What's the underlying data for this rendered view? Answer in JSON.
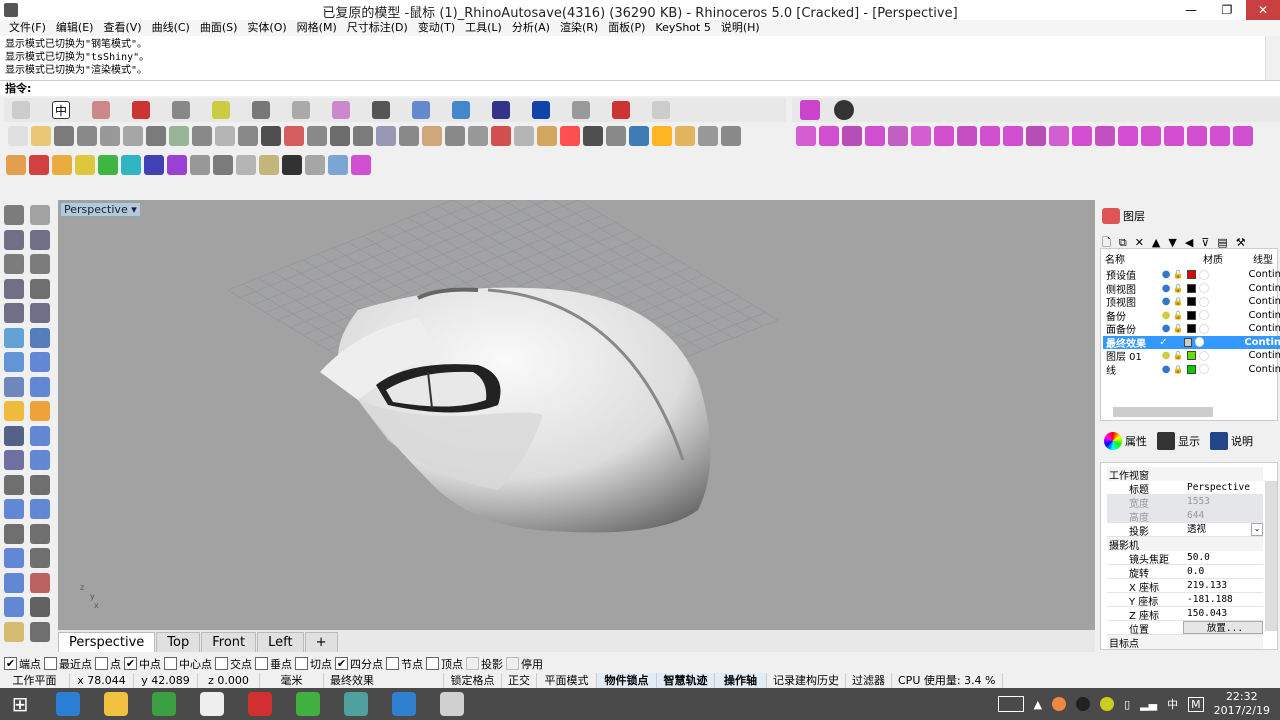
{
  "window": {
    "title": "已复原的模型 -鼠标 (1)_RhinoAutosave(4316) (36290 KB) - Rhinoceros 5.0 [Cracked] - [Perspective]",
    "min": "—",
    "max": "❐",
    "close": "✕",
    "close_color": "#c94040"
  },
  "menu": [
    "文件(F)",
    "编辑(E)",
    "查看(V)",
    "曲线(C)",
    "曲面(S)",
    "实体(O)",
    "网格(M)",
    "尺寸标注(D)",
    "变动(T)",
    "工具(L)",
    "分析(A)",
    "渲染(R)",
    "面板(P)",
    "KeyShot 5",
    "说明(H)"
  ],
  "history": [
    "显示模式已切换为\"钢笔模式\"。",
    "显示模式已切换为\"tsShiny\"。",
    "显示模式已切换为\"渲染模式\"。"
  ],
  "command": {
    "label": "指令:",
    "value": ""
  },
  "toolbar_tabs_left_active": "中",
  "toolbar_colors": {
    "row1": [
      "#ddd",
      "#e8c060",
      "#666",
      "#777",
      "#888",
      "#999",
      "#666",
      "#8a8",
      "#777",
      "#aaa",
      "#777",
      "#333",
      "#c44",
      "#777",
      "#555",
      "#666",
      "#88a",
      "#777",
      "#c96",
      "#777",
      "#888",
      "#c33",
      "#aaa",
      "#c94",
      "#f33",
      "#333",
      "#777",
      "#26a",
      "#fa0",
      "#da4",
      "#888",
      "#777"
    ],
    "row1b": [
      "#c4c",
      "#c3c",
      "#a3a",
      "#c3c",
      "#b4b",
      "#c4c",
      "#c3c",
      "#b3b",
      "#c3c",
      "#c3c",
      "#a3a",
      "#c4c",
      "#c3c",
      "#b3b",
      "#c3c",
      "#c3c",
      "#c3c",
      "#c3c",
      "#c3c",
      "#c3c"
    ],
    "row2": [
      "#e09030",
      "#c22",
      "#e8a020",
      "#d8c020",
      "#2a2",
      "#1ab",
      "#22a",
      "#82c",
      "#888",
      "#666",
      "#aaa",
      "#ba6",
      "#111",
      "#999",
      "#69c",
      "#c3c"
    ]
  },
  "viewport": {
    "label": "Perspective",
    "background": "#a2a2a2",
    "axis": [
      "z",
      "y",
      "x"
    ]
  },
  "viewport_tabs": [
    "Perspective",
    "Top",
    "Front",
    "Left",
    "+"
  ],
  "osnap": [
    {
      "label": "端点",
      "checked": true
    },
    {
      "label": "最近点",
      "checked": false
    },
    {
      "label": "点",
      "checked": false
    },
    {
      "label": "中点",
      "checked": true
    },
    {
      "label": "中心点",
      "checked": false
    },
    {
      "label": "交点",
      "checked": false
    },
    {
      "label": "垂点",
      "checked": false
    },
    {
      "label": "切点",
      "checked": false
    },
    {
      "label": "四分点",
      "checked": true
    },
    {
      "label": "节点",
      "checked": false
    },
    {
      "label": "顶点",
      "checked": false
    },
    {
      "label": "投影",
      "checked": false,
      "disabled": true
    },
    {
      "label": "停用",
      "checked": false,
      "disabled": true
    }
  ],
  "status": {
    "cplane": "工作平面",
    "x": "x 78.044",
    "y": "y 42.089",
    "z": "z 0.000",
    "units": "毫米",
    "layer": "最终效果",
    "grid_snap": "锁定格点",
    "ortho": "正交",
    "planar": "平面模式",
    "osnap": "物件锁点",
    "smarttrack": "智慧轨迹",
    "gumball": "操作轴",
    "history": "记录建构历史",
    "filter": "过滤器",
    "cpu": "CPU 使用量: 3.4 %"
  },
  "layers": {
    "tab": "图层",
    "headers": [
      "名称",
      "材质",
      "线型"
    ],
    "rows": [
      {
        "name": "预设值",
        "color": "#e00000",
        "lock": "unlocked",
        "light": "on",
        "linetype": "Contin"
      },
      {
        "name": "侧视图",
        "color": "#000000",
        "lock": "unlocked",
        "light": "on",
        "linetype": "Contin"
      },
      {
        "name": "顶视图",
        "color": "#000000",
        "lock": "locked",
        "light": "on",
        "linetype": "Contin"
      },
      {
        "name": "备份",
        "color": "#000000",
        "lock": "unlocked",
        "light": "off",
        "linetype": "Contin"
      },
      {
        "name": "面备份",
        "color": "#000000",
        "lock": "unlocked",
        "light": "on",
        "linetype": "Contin"
      },
      {
        "name": "最终效果",
        "color": "#cccccc",
        "current": true,
        "linetype": "Contin",
        "selected": true
      },
      {
        "name": "图层 01",
        "color": "#66dd00",
        "lock": "unlocked",
        "light": "off",
        "linetype": "Contin"
      },
      {
        "name": "线",
        "color": "#00cc00",
        "lock": "locked",
        "light": "on",
        "linetype": "Contin"
      }
    ]
  },
  "properties": {
    "tabs": [
      "属性",
      "显示",
      "说明"
    ],
    "sections": [
      {
        "title": "工作视窗",
        "rows": [
          {
            "k": "标题",
            "v": "Perspective"
          },
          {
            "k": "宽度",
            "v": "1553",
            "disabled": true
          },
          {
            "k": "高度",
            "v": "644",
            "disabled": true
          },
          {
            "k": "投影",
            "v": "透视",
            "dropdown": true
          }
        ]
      },
      {
        "title": "摄影机",
        "rows": [
          {
            "k": "镜头焦距",
            "v": "50.0"
          },
          {
            "k": "旋转",
            "v": "0.0"
          },
          {
            "k": "X 座标",
            "v": "219.133"
          },
          {
            "k": "Y 座标",
            "v": "-181.188"
          },
          {
            "k": "Z 座标",
            "v": "150.043"
          },
          {
            "k": "位置",
            "v": "放置...",
            "button": true
          }
        ]
      },
      {
        "title": "目标点",
        "rows": []
      }
    ]
  },
  "taskbar": {
    "apps": [
      "#2a7fd4",
      "#f0c040",
      "#3aa040",
      "#eeeeee",
      "#d23030",
      "#40b040",
      "#50a0a0",
      "#3080d0",
      "#d0d0d0"
    ],
    "time": "22:32",
    "date": "2017/2/19",
    "ime": "中",
    "ime_mode": "M"
  }
}
